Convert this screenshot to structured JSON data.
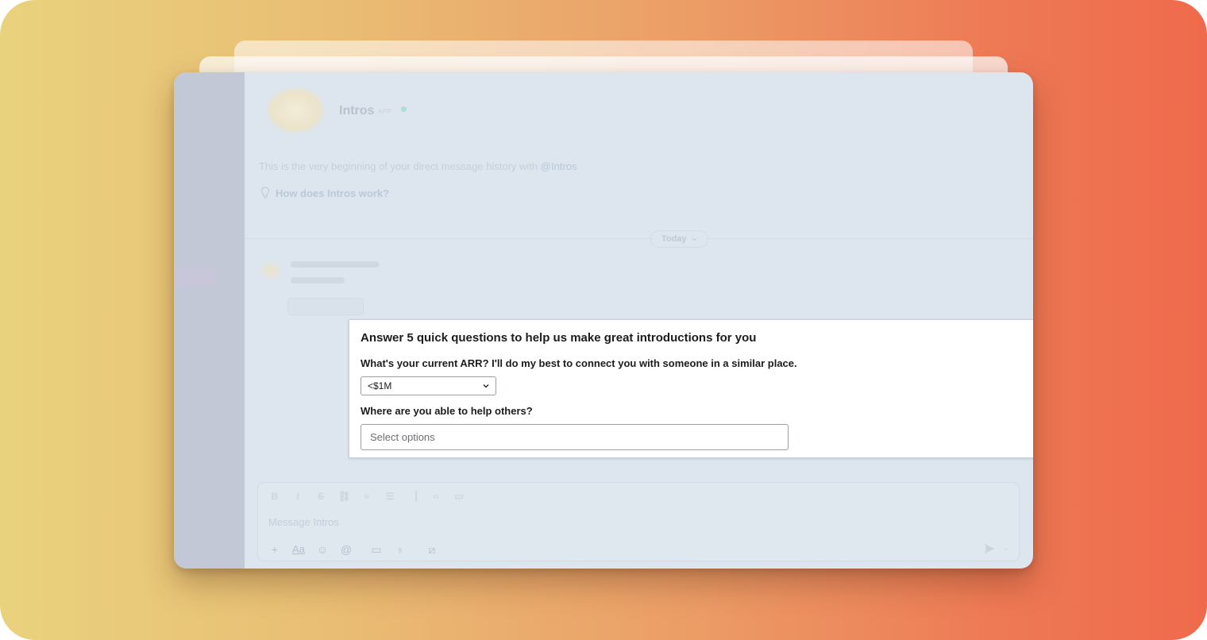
{
  "header": {
    "name": "Intros",
    "app_badge": "APP"
  },
  "intro": {
    "text": "This is the very beginning of your direct message history with",
    "mention": "@Intros",
    "help_link": "How does Intros work?"
  },
  "divider": {
    "date_label": "Today"
  },
  "card": {
    "title": "Answer 5 quick questions to help us make great introductions for you",
    "question_1": "What's your current ARR? I'll do my best to connect you with someone in a similar place.",
    "question_1_value": "<$1M",
    "question_2": "Where are you able to help others?",
    "question_2_placeholder": "Select options"
  },
  "composer": {
    "placeholder": "Message Intros",
    "format_label": "Aa"
  },
  "icons": {
    "chevron": "chevron-down-icon",
    "pin": "lightbulb-icon",
    "send": "send-icon"
  },
  "colors": {
    "gradient_left": "#e9d27e",
    "gradient_right": "#ef6a4c",
    "window_bg": "#dde5ee",
    "sidebar_bg": "#c2c8d6"
  }
}
